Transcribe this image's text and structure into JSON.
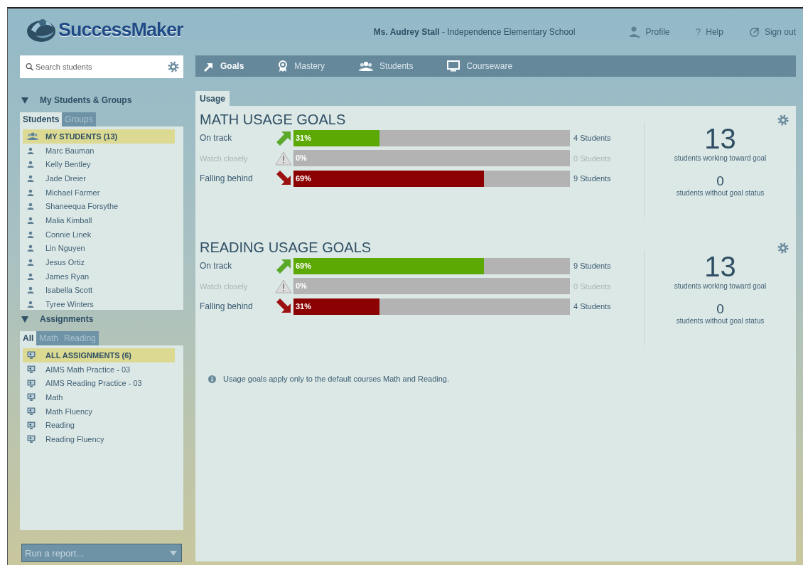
{
  "header": {
    "logo": "SuccessMaker",
    "user": "**Ms. Audrey Stall** - Independence Elementary School",
    "links": [
      {
        "kind": "profile",
        "label": "Profile"
      },
      {
        "kind": "help",
        "glyph": "?",
        "label": "Help"
      },
      {
        "kind": "signout",
        "label": "Sign out"
      }
    ]
  },
  "sidebar": {
    "search": {
      "placeholder": "Search students"
    },
    "sections": [
      {
        "title": "My Students & Groups",
        "expanded": true,
        "tabs": [
          {
            "label": "Students",
            "selected": true
          },
          {
            "label": "Groups",
            "selected": false
          }
        ],
        "items": [
          {
            "kind": "group",
            "label": "MY STUDENTS (13)",
            "selected": true
          },
          {
            "kind": "student",
            "label": "Marc Bauman",
            "selected": false
          },
          {
            "kind": "student",
            "label": "Kelly Bentley",
            "selected": false
          },
          {
            "kind": "student",
            "label": "Jade Dreier",
            "selected": false
          },
          {
            "kind": "student",
            "label": "Michael Farmer",
            "selected": false
          },
          {
            "kind": "student",
            "label": "Shaneequa Forsythe",
            "selected": false
          },
          {
            "kind": "student",
            "label": "Malia Kimball",
            "selected": false
          },
          {
            "kind": "student",
            "label": "Connie Linek",
            "selected": false
          },
          {
            "kind": "student",
            "label": "Lin Nguyen",
            "selected": false
          },
          {
            "kind": "student",
            "label": "Jesus Ortiz",
            "selected": false
          },
          {
            "kind": "student",
            "label": "James Ryan",
            "selected": false
          },
          {
            "kind": "student",
            "label": "Isabella Scott",
            "selected": false
          },
          {
            "kind": "student",
            "label": "Tyree Winters",
            "selected": false
          }
        ]
      },
      {
        "title": "Assignments",
        "expanded": true,
        "tabs": [
          {
            "label": "All",
            "selected": true
          },
          {
            "label": "Math",
            "selected": false
          },
          {
            "label": "Reading",
            "selected": false
          }
        ],
        "items": [
          {
            "kind": "assignment",
            "label": "ALL ASSIGNMENTS (6)",
            "selected": true
          },
          {
            "kind": "assignment",
            "label": "AIMS Math Practice - 03",
            "selected": false
          },
          {
            "kind": "assignment",
            "label": "AIMS Reading Practice - 03",
            "selected": false
          },
          {
            "kind": "assignment",
            "label": "Math",
            "selected": false
          },
          {
            "kind": "assignment",
            "label": "Math Fluency",
            "selected": false
          },
          {
            "kind": "assignment",
            "label": "Reading",
            "selected": false
          },
          {
            "kind": "assignment",
            "label": "Reading Fluency",
            "selected": false
          }
        ]
      }
    ],
    "report_select": {
      "value": "Run a report..."
    }
  },
  "nav": {
    "tabs": [
      {
        "kind": "goals",
        "label": "Goals",
        "selected": true
      },
      {
        "kind": "mastery",
        "label": "Mastery",
        "selected": false
      },
      {
        "kind": "students",
        "label": "Students",
        "selected": false
      },
      {
        "kind": "courseware",
        "label": "Courseware",
        "selected": false
      }
    ]
  },
  "content": {
    "tabs": [
      {
        "label": "Usage",
        "selected": true
      }
    ],
    "goals": [
      {
        "title": "MATH USAGE GOALS",
        "rows": [
          {
            "kind": "on_track",
            "label": "On track",
            "percent": "31%",
            "level": 0.31,
            "count": "4 Students"
          },
          {
            "kind": "watch",
            "label": "Watch closely",
            "percent": "0%",
            "level": 0,
            "count": "0 Students"
          },
          {
            "kind": "behind",
            "label": "Falling behind",
            "percent": "69%",
            "level": 0.69,
            "count": "9 Students"
          }
        ],
        "total": "13",
        "total_label": "students working toward goal",
        "without": "0",
        "without_label": "students without goal status"
      },
      {
        "title": "READING USAGE GOALS",
        "rows": [
          {
            "kind": "on_track",
            "label": "On track",
            "percent": "69%",
            "level": 0.69,
            "count": "9 Students"
          },
          {
            "kind": "watch",
            "label": "Watch closely",
            "percent": "0%",
            "level": 0,
            "count": "0 Students"
          },
          {
            "kind": "behind",
            "label": "Falling behind",
            "percent": "31%",
            "level": 0.31,
            "count": "4 Students"
          }
        ],
        "total": "13",
        "total_label": "students working toward goal",
        "without": "0",
        "without_label": "students without goal status"
      }
    ],
    "note": "Usage goals apply only to the default courses Math and Reading."
  }
}
